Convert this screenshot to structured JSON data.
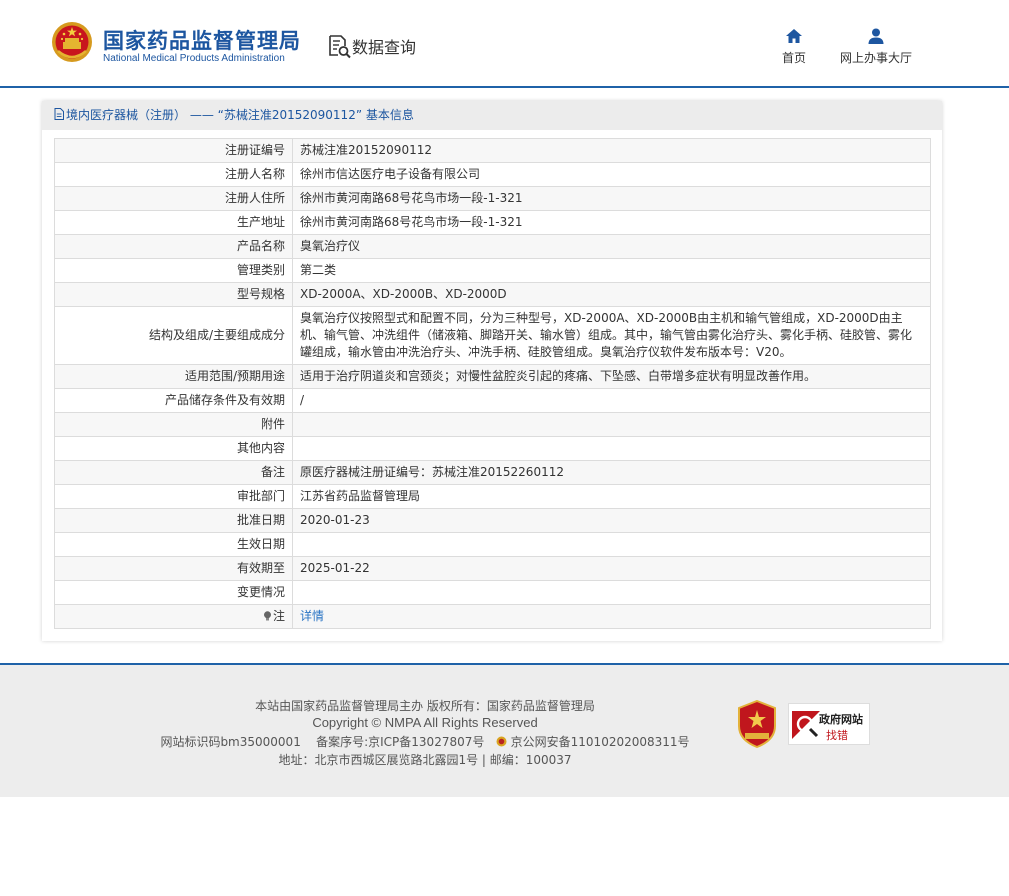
{
  "header": {
    "brand_cn": "国家药品监督管理局",
    "brand_en": "National Medical Products Administration",
    "query_label": "数据查询",
    "nav": [
      {
        "label": "首页",
        "icon": "home-icon"
      },
      {
        "label": "网上办事大厅",
        "icon": "user-icon"
      }
    ],
    "accent_color": "#1f62a8"
  },
  "panel": {
    "title": "境内医疗器械（注册） —— “苏械注准20152090112” 基本信息",
    "rows": [
      {
        "label": "注册证编号",
        "value": "苏械注准20152090112"
      },
      {
        "label": "注册人名称",
        "value": "徐州市信达医疗电子设备有限公司"
      },
      {
        "label": "注册人住所",
        "value": "徐州市黄河南路68号花鸟市场一段-1-321"
      },
      {
        "label": "生产地址",
        "value": "徐州市黄河南路68号花鸟市场一段-1-321"
      },
      {
        "label": "产品名称",
        "value": "臭氧治疗仪"
      },
      {
        "label": "管理类别",
        "value": "第二类"
      },
      {
        "label": "型号规格",
        "value": "XD-2000A、XD-2000B、XD-2000D"
      },
      {
        "label": "结构及组成/主要组成成分",
        "value": "臭氧治疗仪按照型式和配置不同，分为三种型号，XD-2000A、XD-2000B由主机和输气管组成，XD-2000D由主机、输气管、冲洗组件（储液箱、脚踏开关、输水管）组成。其中，输气管由雾化治疗头、雾化手柄、硅胶管、雾化罐组成，输水管由冲洗治疗头、冲洗手柄、硅胶管组成。臭氧治疗仪软件发布版本号：V20。"
      },
      {
        "label": "适用范围/预期用途",
        "value": "适用于治疗阴道炎和宫颈炎；对慢性盆腔炎引起的疼痛、下坠感、白带增多症状有明显改善作用。"
      },
      {
        "label": "产品储存条件及有效期",
        "value": "/"
      },
      {
        "label": "附件",
        "value": ""
      },
      {
        "label": "其他内容",
        "value": ""
      },
      {
        "label": "备注",
        "value": "原医疗器械注册证编号：苏械注准20152260112"
      },
      {
        "label": "审批部门",
        "value": "江苏省药品监督管理局"
      },
      {
        "label": "批准日期",
        "value": "2020-01-23"
      },
      {
        "label": "生效日期",
        "value": ""
      },
      {
        "label": "有效期至",
        "value": "2025-01-22"
      },
      {
        "label": "变更情况",
        "value": ""
      }
    ],
    "note_label": "注",
    "note_link": "详情"
  },
  "footer": {
    "line1": "本站由国家药品监督管理局主办 版权所有：国家药品监督管理局",
    "line2": "Copyright © NMPA All Rights Reserved",
    "site_id": "网站标识码bm35000001",
    "icp": "备案序号:京ICP备13027807号",
    "police": "京公网安备11010202008311号",
    "address": "地址：北京市西城区展览路北露园1号 | 邮编：100037",
    "gov_badge_t1": "政府网站",
    "gov_badge_t2": "找错"
  }
}
